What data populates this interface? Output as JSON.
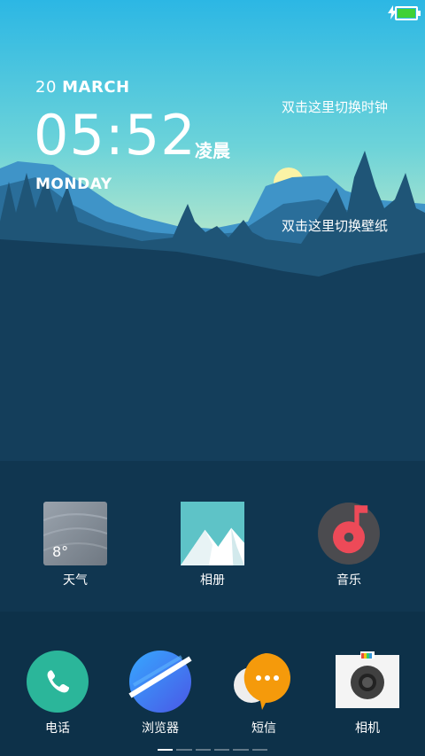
{
  "status_bar": {
    "icons": [
      "charging-bolt-icon",
      "battery-icon"
    ],
    "battery_color": "#3fd136"
  },
  "clock": {
    "day": "20",
    "month": "MARCH",
    "time": "05:52",
    "period": "凌晨",
    "weekday": "MONDAY"
  },
  "hints": {
    "switch_clock": "双击这里切换时钟",
    "switch_wallpaper": "双击这里切换壁纸"
  },
  "apps": {
    "weather": {
      "label": "天气",
      "temp": "8°",
      "icon": "weather-icon"
    },
    "gallery": {
      "label": "相册",
      "icon": "gallery-icon"
    },
    "music": {
      "label": "音乐",
      "icon": "music-icon"
    }
  },
  "dock": {
    "phone": {
      "label": "电话",
      "icon": "phone-icon",
      "color": "#2bb69a"
    },
    "browser": {
      "label": "浏览器",
      "icon": "browser-icon",
      "color": "#3d7bff"
    },
    "messages": {
      "label": "短信",
      "icon": "message-icon",
      "color": "#f59a0b"
    },
    "camera": {
      "label": "相机",
      "icon": "camera-icon"
    }
  },
  "page_indicator": {
    "total_pages": 6,
    "current_page": 1
  }
}
